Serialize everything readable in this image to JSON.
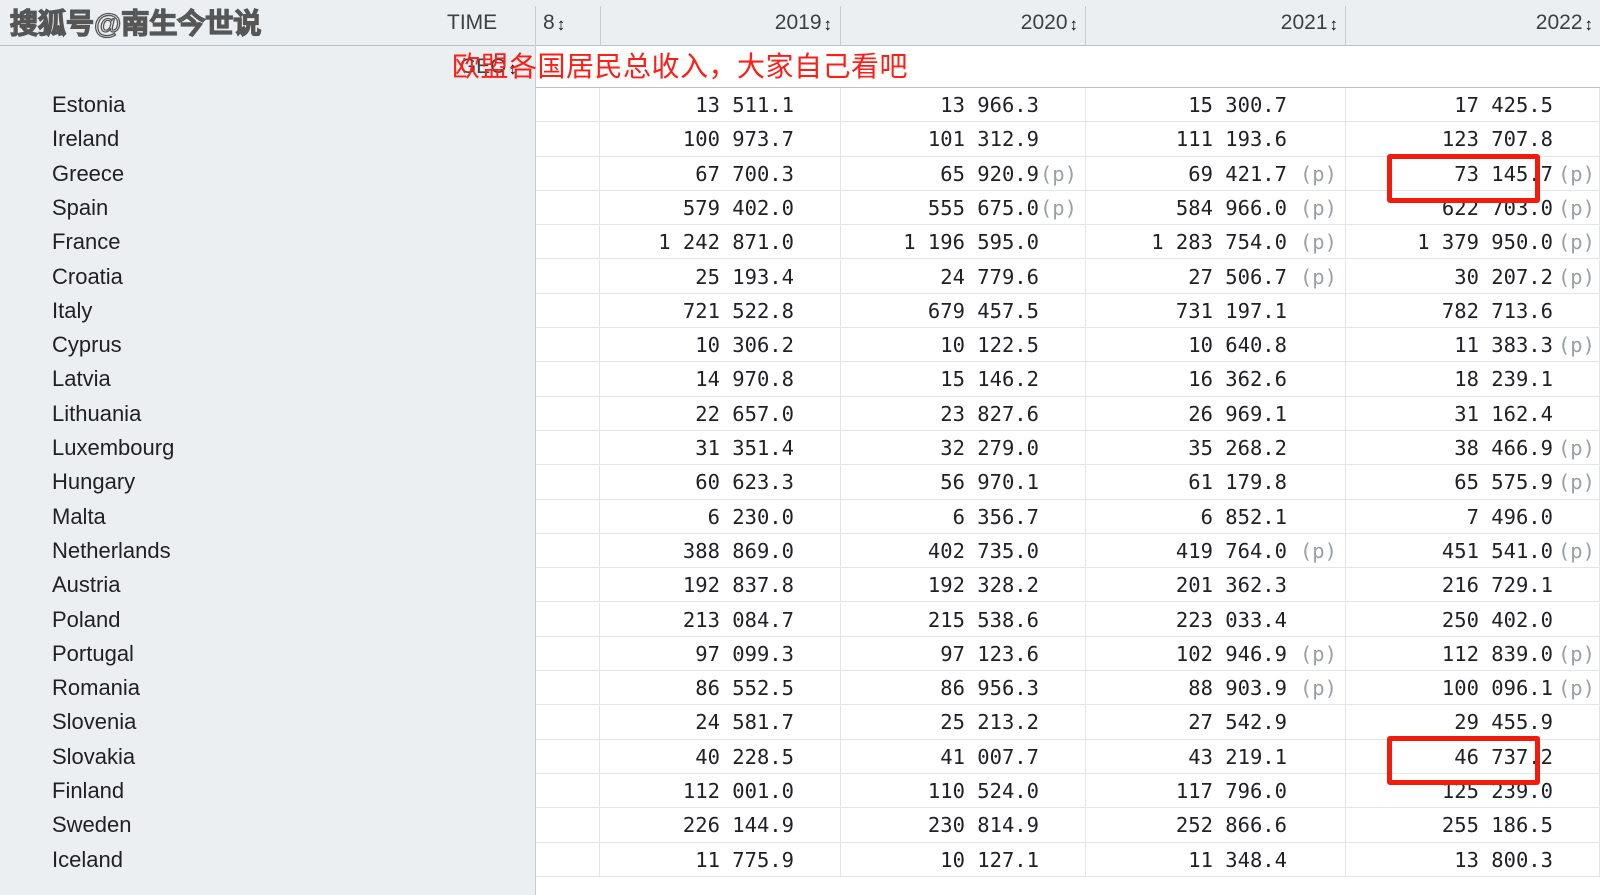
{
  "watermark": {
    "text": "搜狐号@南生今世说"
  },
  "annotation": {
    "note": "欧盟各国居民总收入，大家自己看吧",
    "color": "#ff1d15"
  },
  "header": {
    "time_label": "TIME",
    "unit_col": "8",
    "sort_icon": "↕",
    "geo_label": "GEO",
    "years": [
      "2019",
      "2020",
      "2021",
      "2022"
    ]
  },
  "table": {
    "columns": [
      "GEO",
      "2019",
      "2020",
      "2021",
      "2022"
    ],
    "provisional_flag": "(p)",
    "rows": [
      {
        "geo": "Estonia",
        "v2019": "13 511.1",
        "f2019": "",
        "v2020": "13 966.3",
        "f2020": "",
        "v2021": "15 300.7",
        "f2021": "",
        "v2022": "17 425.5",
        "f2022": ""
      },
      {
        "geo": "Ireland",
        "v2019": "100 973.7",
        "f2019": "",
        "v2020": "101 312.9",
        "f2020": "",
        "v2021": "111 193.6",
        "f2021": "",
        "v2022": "123 707.8",
        "f2022": ""
      },
      {
        "geo": "Greece",
        "v2019": "67 700.3",
        "f2019": "",
        "v2020": "65 920.9",
        "f2020": "(p)",
        "v2021": "69 421.7",
        "f2021": "(p)",
        "v2022": "73 145.7",
        "f2022": "(p)"
      },
      {
        "geo": "Spain",
        "v2019": "579 402.0",
        "f2019": "",
        "v2020": "555 675.0",
        "f2020": "(p)",
        "v2021": "584 966.0",
        "f2021": "(p)",
        "v2022": "622 703.0",
        "f2022": "(p)"
      },
      {
        "geo": "France",
        "v2019": "1 242 871.0",
        "f2019": "",
        "v2020": "1 196 595.0",
        "f2020": "",
        "v2021": "1 283 754.0",
        "f2021": "(p)",
        "v2022": "1 379 950.0",
        "f2022": "(p)"
      },
      {
        "geo": "Croatia",
        "v2019": "25 193.4",
        "f2019": "",
        "v2020": "24 779.6",
        "f2020": "",
        "v2021": "27 506.7",
        "f2021": "(p)",
        "v2022": "30 207.2",
        "f2022": "(p)"
      },
      {
        "geo": "Italy",
        "v2019": "721 522.8",
        "f2019": "",
        "v2020": "679 457.5",
        "f2020": "",
        "v2021": "731 197.1",
        "f2021": "",
        "v2022": "782 713.6",
        "f2022": ""
      },
      {
        "geo": "Cyprus",
        "v2019": "10 306.2",
        "f2019": "",
        "v2020": "10 122.5",
        "f2020": "",
        "v2021": "10 640.8",
        "f2021": "",
        "v2022": "11 383.3",
        "f2022": "(p)"
      },
      {
        "geo": "Latvia",
        "v2019": "14 970.8",
        "f2019": "",
        "v2020": "15 146.2",
        "f2020": "",
        "v2021": "16 362.6",
        "f2021": "",
        "v2022": "18 239.1",
        "f2022": ""
      },
      {
        "geo": "Lithuania",
        "v2019": "22 657.0",
        "f2019": "",
        "v2020": "23 827.6",
        "f2020": "",
        "v2021": "26 969.1",
        "f2021": "",
        "v2022": "31 162.4",
        "f2022": ""
      },
      {
        "geo": "Luxembourg",
        "v2019": "31 351.4",
        "f2019": "",
        "v2020": "32 279.0",
        "f2020": "",
        "v2021": "35 268.2",
        "f2021": "",
        "v2022": "38 466.9",
        "f2022": "(p)"
      },
      {
        "geo": "Hungary",
        "v2019": "60 623.3",
        "f2019": "",
        "v2020": "56 970.1",
        "f2020": "",
        "v2021": "61 179.8",
        "f2021": "",
        "v2022": "65 575.9",
        "f2022": "(p)"
      },
      {
        "geo": "Malta",
        "v2019": "6 230.0",
        "f2019": "",
        "v2020": "6 356.7",
        "f2020": "",
        "v2021": "6 852.1",
        "f2021": "",
        "v2022": "7 496.0",
        "f2022": ""
      },
      {
        "geo": "Netherlands",
        "v2019": "388 869.0",
        "f2019": "",
        "v2020": "402 735.0",
        "f2020": "",
        "v2021": "419 764.0",
        "f2021": "(p)",
        "v2022": "451 541.0",
        "f2022": "(p)"
      },
      {
        "geo": "Austria",
        "v2019": "192 837.8",
        "f2019": "",
        "v2020": "192 328.2",
        "f2020": "",
        "v2021": "201 362.3",
        "f2021": "",
        "v2022": "216 729.1",
        "f2022": ""
      },
      {
        "geo": "Poland",
        "v2019": "213 084.7",
        "f2019": "",
        "v2020": "215 538.6",
        "f2020": "",
        "v2021": "223 033.4",
        "f2021": "",
        "v2022": "250 402.0",
        "f2022": ""
      },
      {
        "geo": "Portugal",
        "v2019": "97 099.3",
        "f2019": "",
        "v2020": "97 123.6",
        "f2020": "",
        "v2021": "102 946.9",
        "f2021": "(p)",
        "v2022": "112 839.0",
        "f2022": "(p)"
      },
      {
        "geo": "Romania",
        "v2019": "86 552.5",
        "f2019": "",
        "v2020": "86 956.3",
        "f2020": "",
        "v2021": "88 903.9",
        "f2021": "(p)",
        "v2022": "100 096.1",
        "f2022": "(p)"
      },
      {
        "geo": "Slovenia",
        "v2019": "24 581.7",
        "f2019": "",
        "v2020": "25 213.2",
        "f2020": "",
        "v2021": "27 542.9",
        "f2021": "",
        "v2022": "29 455.9",
        "f2022": ""
      },
      {
        "geo": "Slovakia",
        "v2019": "40 228.5",
        "f2019": "",
        "v2020": "41 007.7",
        "f2020": "",
        "v2021": "43 219.1",
        "f2021": "",
        "v2022": "46 737.2",
        "f2022": ""
      },
      {
        "geo": "Finland",
        "v2019": "112 001.0",
        "f2019": "",
        "v2020": "110 524.0",
        "f2020": "",
        "v2021": "117 796.0",
        "f2021": "",
        "v2022": "125 239.0",
        "f2022": ""
      },
      {
        "geo": "Sweden",
        "v2019": "226 144.9",
        "f2019": "",
        "v2020": "230 814.9",
        "f2020": "",
        "v2021": "252 866.6",
        "f2021": "",
        "v2022": "255 186.5",
        "f2022": ""
      },
      {
        "geo": "Iceland",
        "v2019": "11 775.9",
        "f2019": "",
        "v2020": "10 127.1",
        "f2020": "",
        "v2021": "11 348.4",
        "f2021": "",
        "v2022": "13 800.3",
        "f2022": ""
      }
    ]
  },
  "highlights": [
    {
      "value": "73 145.7",
      "geo": "Greece",
      "year": "2022"
    },
    {
      "value": "46 737.2",
      "geo": "Slovakia",
      "year": "2022"
    }
  ]
}
